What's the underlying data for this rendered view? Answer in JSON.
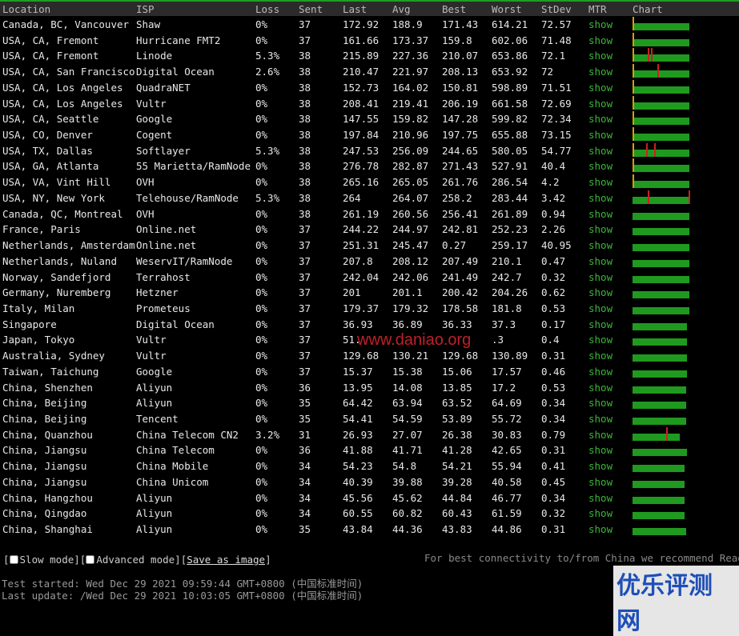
{
  "columns": [
    "Location",
    "ISP",
    "Loss",
    "Sent",
    "Last",
    "Avg",
    "Best",
    "Worst",
    "StDev",
    "MTR",
    "Chart"
  ],
  "rows": [
    {
      "location": "Canada, BC, Vancouver",
      "isp": "Shaw",
      "loss": "0%",
      "sent": "37",
      "last": "172.92",
      "avg": "188.9",
      "best": "171.43",
      "worst": "614.21",
      "stdev": "72.57",
      "mtr": "show",
      "chart": {
        "fill": 0.98,
        "spikes": [],
        "tick": true
      }
    },
    {
      "location": "USA, CA, Fremont",
      "isp": "Hurricane FMT2",
      "loss": "0%",
      "sent": "37",
      "last": "161.66",
      "avg": "173.37",
      "best": "159.8",
      "worst": "602.06",
      "stdev": "71.48",
      "mtr": "show",
      "chart": {
        "fill": 0.98,
        "spikes": [],
        "tick": true
      }
    },
    {
      "location": "USA, CA, Fremont",
      "isp": "Linode",
      "loss": "5.3%",
      "sent": "38",
      "last": "215.89",
      "avg": "227.36",
      "best": "210.07",
      "worst": "653.86",
      "stdev": "72.1",
      "mtr": "show",
      "chart": {
        "fill": 0.98,
        "spikes": [
          0.27,
          0.32
        ],
        "tick": true
      }
    },
    {
      "location": "USA, CA, San Francisco",
      "isp": "Digital Ocean",
      "loss": "2.6%",
      "sent": "38",
      "last": "210.47",
      "avg": "221.97",
      "best": "208.13",
      "worst": "653.92",
      "stdev": "72",
      "mtr": "show",
      "chart": {
        "fill": 0.98,
        "spikes": [
          0.43
        ],
        "tick": true
      }
    },
    {
      "location": "USA, CA, Los Angeles",
      "isp": "QuadraNET",
      "loss": "0%",
      "sent": "38",
      "last": "152.73",
      "avg": "164.02",
      "best": "150.81",
      "worst": "598.89",
      "stdev": "71.51",
      "mtr": "show",
      "chart": {
        "fill": 0.98,
        "spikes": [],
        "tick": true
      }
    },
    {
      "location": "USA, CA, Los Angeles",
      "isp": "Vultr",
      "loss": "0%",
      "sent": "38",
      "last": "208.41",
      "avg": "219.41",
      "best": "206.19",
      "worst": "661.58",
      "stdev": "72.69",
      "mtr": "show",
      "chart": {
        "fill": 0.98,
        "spikes": [],
        "tick": true
      }
    },
    {
      "location": "USA, CA, Seattle",
      "isp": "Google",
      "loss": "0%",
      "sent": "38",
      "last": "147.55",
      "avg": "159.82",
      "best": "147.28",
      "worst": "599.82",
      "stdev": "72.34",
      "mtr": "show",
      "chart": {
        "fill": 0.98,
        "spikes": [],
        "tick": true
      }
    },
    {
      "location": "USA, CO, Denver",
      "isp": "Cogent",
      "loss": "0%",
      "sent": "38",
      "last": "197.84",
      "avg": "210.96",
      "best": "197.75",
      "worst": "655.88",
      "stdev": "73.15",
      "mtr": "show",
      "chart": {
        "fill": 0.98,
        "spikes": [],
        "tick": true
      }
    },
    {
      "location": "USA, TX, Dallas",
      "isp": "Softlayer",
      "loss": "5.3%",
      "sent": "38",
      "last": "247.53",
      "avg": "256.09",
      "best": "244.65",
      "worst": "580.05",
      "stdev": "54.77",
      "mtr": "show",
      "chart": {
        "fill": 0.98,
        "spikes": [
          0.23,
          0.37
        ],
        "tick": true
      }
    },
    {
      "location": "USA, GA, Atlanta",
      "isp": "55 Marietta/RamNode",
      "loss": "0%",
      "sent": "38",
      "last": "276.78",
      "avg": "282.87",
      "best": "271.43",
      "worst": "527.91",
      "stdev": "40.4",
      "mtr": "show",
      "chart": {
        "fill": 0.98,
        "spikes": [],
        "tick": true
      }
    },
    {
      "location": "USA, VA, Vint Hill",
      "isp": "OVH",
      "loss": "0%",
      "sent": "38",
      "last": "265.16",
      "avg": "265.05",
      "best": "261.76",
      "worst": "286.54",
      "stdev": "4.2",
      "mtr": "show",
      "chart": {
        "fill": 0.98,
        "spikes": [],
        "tick": true
      }
    },
    {
      "location": "USA, NY, New York",
      "isp": "Telehouse/RamNode",
      "loss": "5.3%",
      "sent": "38",
      "last": "264",
      "avg": "264.07",
      "best": "258.2",
      "worst": "283.44",
      "stdev": "3.42",
      "mtr": "show",
      "chart": {
        "fill": 0.98,
        "spikes": [
          0.27,
          0.97
        ],
        "tick": false
      }
    },
    {
      "location": "Canada, QC, Montreal",
      "isp": "OVH",
      "loss": "0%",
      "sent": "38",
      "last": "261.19",
      "avg": "260.56",
      "best": "256.41",
      "worst": "261.89",
      "stdev": "0.94",
      "mtr": "show",
      "chart": {
        "fill": 0.98,
        "spikes": [],
        "tick": false
      }
    },
    {
      "location": "France, Paris",
      "isp": "Online.net",
      "loss": "0%",
      "sent": "37",
      "last": "244.22",
      "avg": "244.97",
      "best": "242.81",
      "worst": "252.23",
      "stdev": "2.26",
      "mtr": "show",
      "chart": {
        "fill": 0.98,
        "spikes": [],
        "tick": false
      }
    },
    {
      "location": "Netherlands, Amsterdam",
      "isp": "Online.net",
      "loss": "0%",
      "sent": "37",
      "last": "251.31",
      "avg": "245.47",
      "best": "0.27",
      "worst": "259.17",
      "stdev": "40.95",
      "mtr": "show",
      "chart": {
        "fill": 0.98,
        "spikes": [],
        "tick": false
      }
    },
    {
      "location": "Netherlands, Nuland",
      "isp": "WeservIT/RamNode",
      "loss": "0%",
      "sent": "37",
      "last": "207.8",
      "avg": "208.12",
      "best": "207.49",
      "worst": "210.1",
      "stdev": "0.47",
      "mtr": "show",
      "chart": {
        "fill": 0.98,
        "spikes": [],
        "tick": false
      }
    },
    {
      "location": "Norway, Sandefjord",
      "isp": "Terrahost",
      "loss": "0%",
      "sent": "37",
      "last": "242.04",
      "avg": "242.06",
      "best": "241.49",
      "worst": "242.7",
      "stdev": "0.32",
      "mtr": "show",
      "chart": {
        "fill": 0.98,
        "spikes": [],
        "tick": false
      }
    },
    {
      "location": "Germany, Nuremberg",
      "isp": "Hetzner",
      "loss": "0%",
      "sent": "37",
      "last": "201",
      "avg": "201.1",
      "best": "200.42",
      "worst": "204.26",
      "stdev": "0.62",
      "mtr": "show",
      "chart": {
        "fill": 0.98,
        "spikes": [],
        "tick": false
      }
    },
    {
      "location": "Italy, Milan",
      "isp": "Prometeus",
      "loss": "0%",
      "sent": "37",
      "last": "179.37",
      "avg": "179.32",
      "best": "178.58",
      "worst": "181.8",
      "stdev": "0.53",
      "mtr": "show",
      "chart": {
        "fill": 0.98,
        "spikes": [],
        "tick": false
      }
    },
    {
      "location": "Singapore",
      "isp": "Digital Ocean",
      "loss": "0%",
      "sent": "37",
      "last": "36.93",
      "avg": "36.89",
      "best": "36.33",
      "worst": "37.3",
      "stdev": "0.17",
      "mtr": "show",
      "chart": {
        "fill": 0.95,
        "spikes": [],
        "tick": false
      }
    },
    {
      "location": "Japan, Tokyo",
      "isp": "Vultr",
      "loss": "0%",
      "sent": "37",
      "last": "51.",
      "avg": "",
      "best": "",
      "worst": ".3",
      "stdev": "0.4",
      "mtr": "show",
      "chart": {
        "fill": 0.95,
        "spikes": [],
        "tick": false
      }
    },
    {
      "location": "Australia, Sydney",
      "isp": "Vultr",
      "loss": "0%",
      "sent": "37",
      "last": "129.68",
      "avg": "130.21",
      "best": "129.68",
      "worst": "130.89",
      "stdev": "0.31",
      "mtr": "show",
      "chart": {
        "fill": 0.95,
        "spikes": [],
        "tick": false
      }
    },
    {
      "location": "Taiwan, Taichung",
      "isp": "Google",
      "loss": "0%",
      "sent": "37",
      "last": "15.37",
      "avg": "15.38",
      "best": "15.06",
      "worst": "17.57",
      "stdev": "0.46",
      "mtr": "show",
      "chart": {
        "fill": 0.95,
        "spikes": [],
        "tick": false
      }
    },
    {
      "location": "China, Shenzhen",
      "isp": "Aliyun",
      "loss": "0%",
      "sent": "36",
      "last": "13.95",
      "avg": "14.08",
      "best": "13.85",
      "worst": "17.2",
      "stdev": "0.53",
      "mtr": "show",
      "chart": {
        "fill": 0.93,
        "spikes": [],
        "tick": false
      }
    },
    {
      "location": "China, Beijing",
      "isp": "Aliyun",
      "loss": "0%",
      "sent": "35",
      "last": "64.42",
      "avg": "63.94",
      "best": "63.52",
      "worst": "64.69",
      "stdev": "0.34",
      "mtr": "show",
      "chart": {
        "fill": 0.93,
        "spikes": [],
        "tick": false
      }
    },
    {
      "location": "China, Beijing",
      "isp": "Tencent",
      "loss": "0%",
      "sent": "35",
      "last": "54.41",
      "avg": "54.59",
      "best": "53.89",
      "worst": "55.72",
      "stdev": "0.34",
      "mtr": "show",
      "chart": {
        "fill": 0.93,
        "spikes": [],
        "tick": false
      }
    },
    {
      "location": "China, Quanzhou",
      "isp": "China Telecom CN2",
      "loss": "3.2%",
      "sent": "31",
      "last": "26.93",
      "avg": "27.07",
      "best": "26.38",
      "worst": "30.83",
      "stdev": "0.79",
      "mtr": "show",
      "chart": {
        "fill": 0.82,
        "spikes": [
          0.58
        ],
        "tick": false
      }
    },
    {
      "location": "China, Jiangsu",
      "isp": "China Telecom",
      "loss": "0%",
      "sent": "36",
      "last": "41.88",
      "avg": "41.71",
      "best": "41.28",
      "worst": "42.65",
      "stdev": "0.31",
      "mtr": "show",
      "chart": {
        "fill": 0.95,
        "spikes": [],
        "tick": false
      }
    },
    {
      "location": "China, Jiangsu",
      "isp": "China Mobile",
      "loss": "0%",
      "sent": "34",
      "last": "54.23",
      "avg": "54.8",
      "best": "54.21",
      "worst": "55.94",
      "stdev": "0.41",
      "mtr": "show",
      "chart": {
        "fill": 0.9,
        "spikes": [],
        "tick": false
      }
    },
    {
      "location": "China, Jiangsu",
      "isp": "China Unicom",
      "loss": "0%",
      "sent": "34",
      "last": "40.39",
      "avg": "39.88",
      "best": "39.28",
      "worst": "40.58",
      "stdev": "0.45",
      "mtr": "show",
      "chart": {
        "fill": 0.9,
        "spikes": [],
        "tick": false
      }
    },
    {
      "location": "China, Hangzhou",
      "isp": "Aliyun",
      "loss": "0%",
      "sent": "34",
      "last": "45.56",
      "avg": "45.62",
      "best": "44.84",
      "worst": "46.77",
      "stdev": "0.34",
      "mtr": "show",
      "chart": {
        "fill": 0.9,
        "spikes": [],
        "tick": false
      }
    },
    {
      "location": "China, Qingdao",
      "isp": "Aliyun",
      "loss": "0%",
      "sent": "34",
      "last": "60.55",
      "avg": "60.82",
      "best": "60.43",
      "worst": "61.59",
      "stdev": "0.32",
      "mtr": "show",
      "chart": {
        "fill": 0.9,
        "spikes": [],
        "tick": false
      }
    },
    {
      "location": "China, Shanghai",
      "isp": "Aliyun",
      "loss": "0%",
      "sent": "35",
      "last": "43.84",
      "avg": "44.36",
      "best": "43.83",
      "worst": "44.86",
      "stdev": "0.31",
      "mtr": "show",
      "chart": {
        "fill": 0.93,
        "spikes": [],
        "tick": false
      }
    }
  ],
  "footer": {
    "slow_mode": "Slow mode",
    "advanced_mode": "Advanced mode",
    "save_as_image": "Save as image",
    "hint": "For best connectivity to/from China we recommend Read",
    "test_started": "Test started: Wed Dec 29 2021 09:59:44 GMT+0800 (中国标准时间)",
    "last_update": "Last update: /Wed Dec 29 2021 10:03:05 GMT+0800 (中国标准时间)"
  },
  "watermark": "www.daniao.org",
  "brand": "优乐评测网",
  "colors": {
    "bar": "#1f9a1f",
    "spike": "#cc2020",
    "tick": "#d4a000",
    "show": "#3cb53c"
  }
}
